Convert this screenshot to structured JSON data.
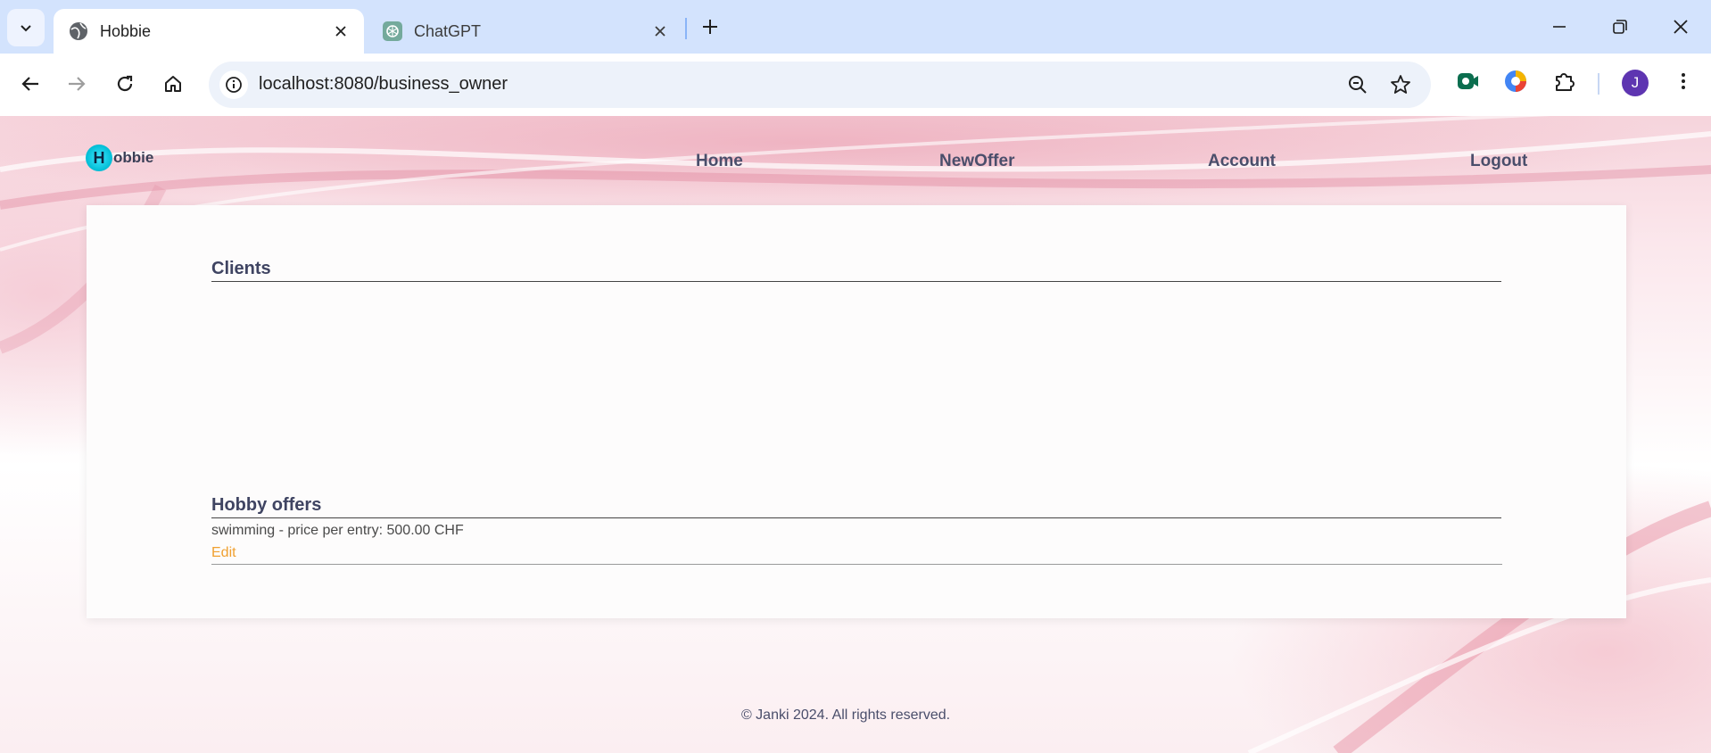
{
  "browser": {
    "tabs": [
      {
        "title": "Hobbie",
        "active": true,
        "icon": "globe-icon"
      },
      {
        "title": "ChatGPT",
        "active": false,
        "icon": "chatgpt-icon"
      }
    ],
    "url": "localhost:8080/business_owner",
    "avatar_initial": "J",
    "accent": "#d3e3fd"
  },
  "site": {
    "logo_letter": "H",
    "logo_text": "obbie",
    "nav": [
      {
        "label": "Home"
      },
      {
        "label": "NewOffer"
      },
      {
        "label": "Account"
      },
      {
        "label": "Logout"
      }
    ]
  },
  "main": {
    "clients_title": "Clients",
    "offers_title": "Hobby offers",
    "offers": [
      {
        "text": "swimming - price per entry: 500.00 CHF",
        "edit_label": "Edit"
      }
    ]
  },
  "footer": {
    "text": "© Janki 2024. All rights reserved."
  },
  "colors": {
    "nav_text": "#4a4e6b",
    "edit_link": "#f0a030",
    "logo_circle": "#00bcd4"
  }
}
